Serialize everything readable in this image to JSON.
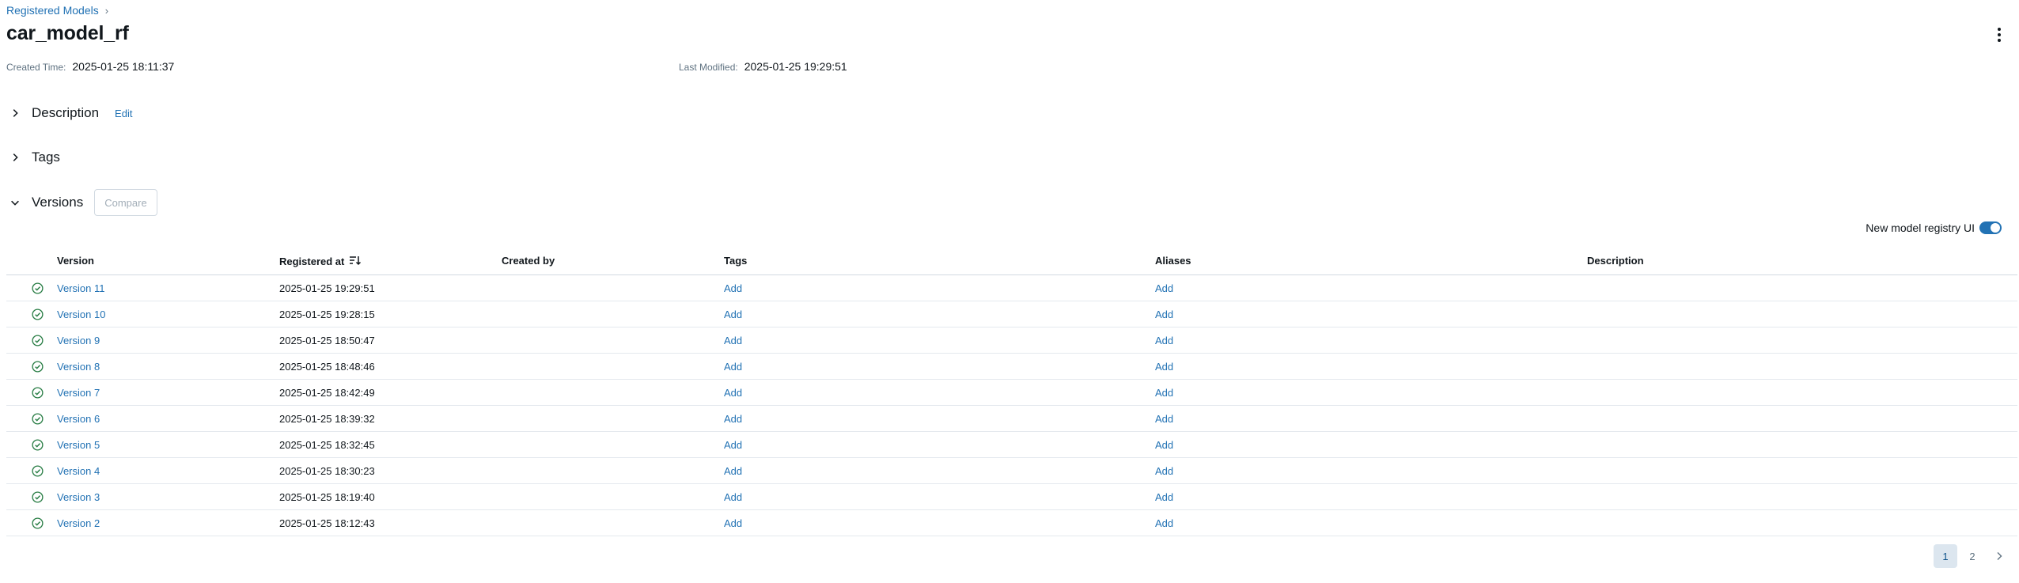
{
  "breadcrumb": {
    "parent": "Registered Models",
    "separator": "›"
  },
  "title": "car_model_rf",
  "meta": {
    "created_label": "Created Time:",
    "created_value": "2025-01-25 18:11:37",
    "modified_label": "Last Modified:",
    "modified_value": "2025-01-25 19:29:51"
  },
  "sections": {
    "description": {
      "title": "Description",
      "edit_label": "Edit"
    },
    "tags": {
      "title": "Tags"
    },
    "versions": {
      "title": "Versions",
      "compare_label": "Compare"
    }
  },
  "toggle": {
    "label": "New model registry UI",
    "on": true
  },
  "table": {
    "columns": {
      "version": "Version",
      "registered_at": "Registered at",
      "created_by": "Created by",
      "tags": "Tags",
      "aliases": "Aliases",
      "description": "Description"
    },
    "rows": [
      {
        "version": "Version 11",
        "registered_at": "2025-01-25 19:29:51",
        "created_by": "",
        "tags": "Add",
        "aliases": "Add",
        "description": ""
      },
      {
        "version": "Version 10",
        "registered_at": "2025-01-25 19:28:15",
        "created_by": "",
        "tags": "Add",
        "aliases": "Add",
        "description": ""
      },
      {
        "version": "Version 9",
        "registered_at": "2025-01-25 18:50:47",
        "created_by": "",
        "tags": "Add",
        "aliases": "Add",
        "description": ""
      },
      {
        "version": "Version 8",
        "registered_at": "2025-01-25 18:48:46",
        "created_by": "",
        "tags": "Add",
        "aliases": "Add",
        "description": ""
      },
      {
        "version": "Version 7",
        "registered_at": "2025-01-25 18:42:49",
        "created_by": "",
        "tags": "Add",
        "aliases": "Add",
        "description": ""
      },
      {
        "version": "Version 6",
        "registered_at": "2025-01-25 18:39:32",
        "created_by": "",
        "tags": "Add",
        "aliases": "Add",
        "description": ""
      },
      {
        "version": "Version 5",
        "registered_at": "2025-01-25 18:32:45",
        "created_by": "",
        "tags": "Add",
        "aliases": "Add",
        "description": ""
      },
      {
        "version": "Version 4",
        "registered_at": "2025-01-25 18:30:23",
        "created_by": "",
        "tags": "Add",
        "aliases": "Add",
        "description": ""
      },
      {
        "version": "Version 3",
        "registered_at": "2025-01-25 18:19:40",
        "created_by": "",
        "tags": "Add",
        "aliases": "Add",
        "description": ""
      },
      {
        "version": "Version 2",
        "registered_at": "2025-01-25 18:12:43",
        "created_by": "",
        "tags": "Add",
        "aliases": "Add",
        "description": ""
      }
    ]
  },
  "pagination": {
    "pages": [
      "1",
      "2"
    ],
    "current": "1"
  },
  "colors": {
    "link": "#2272b4",
    "status_ready": "#277c43",
    "toggle_on": "#2272b4",
    "page_active_bg": "#dce6ef"
  },
  "icons": {
    "row_status": "check-circle-icon",
    "sort": "sort-descending-icon",
    "more": "kebab-menu-icon"
  }
}
